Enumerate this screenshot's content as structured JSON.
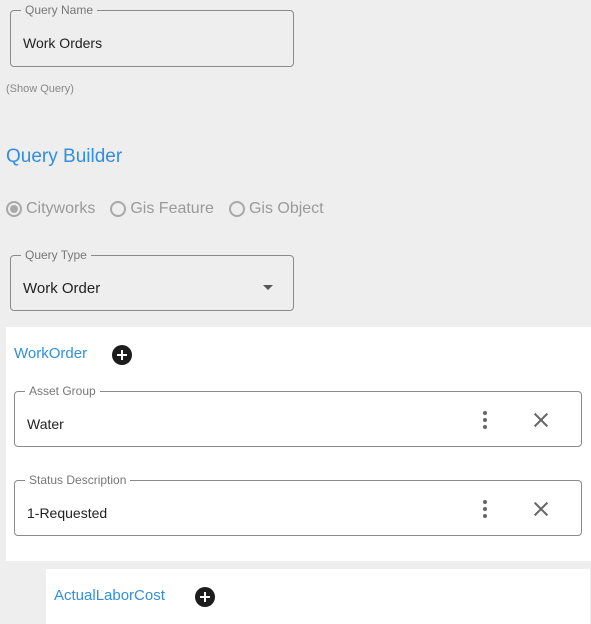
{
  "query_name": {
    "label": "Query Name",
    "value": "Work Orders"
  },
  "show_query_link": "(Show Query)",
  "query_builder": {
    "title": "Query Builder",
    "source_options": [
      {
        "label": "Cityworks",
        "selected": true
      },
      {
        "label": "Gis Feature",
        "selected": false
      },
      {
        "label": "Gis Object",
        "selected": false
      }
    ],
    "query_type": {
      "label": "Query Type",
      "value": "Work Order"
    }
  },
  "workorder_group": {
    "title": "WorkOrder",
    "filters": [
      {
        "label": "Asset Group",
        "value": "Water"
      },
      {
        "label": "Status Description",
        "value": "1-Requested"
      }
    ]
  },
  "labor_group": {
    "title": "ActualLaborCost"
  },
  "icons": {
    "add": "plus-circle-icon",
    "more": "more-vertical-icon",
    "clear": "close-icon",
    "dropdown": "caret-down-icon"
  },
  "colors": {
    "accent": "#2f8fe0",
    "background": "#eeeeee",
    "panel": "#ffffff"
  }
}
